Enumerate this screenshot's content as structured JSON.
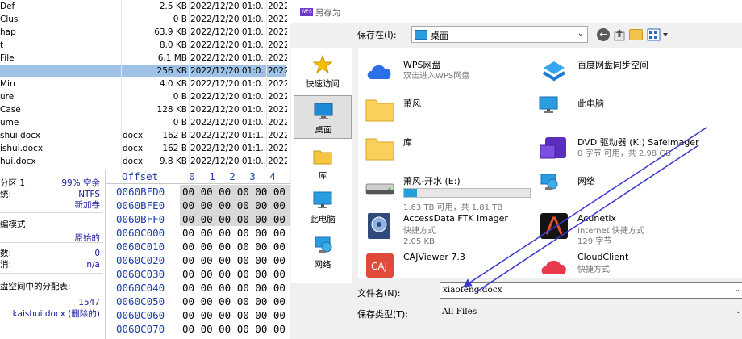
{
  "file_list": {
    "rows": [
      {
        "name": "Def",
        "ext": "",
        "size": "2.5 KB",
        "date": "2022/12/20  01:0...",
        "date2": "2022",
        "selected": false
      },
      {
        "name": "Clus",
        "ext": "",
        "size": "0 B",
        "date": "2022/12/20  01:0...",
        "date2": "2022",
        "selected": false
      },
      {
        "name": "hap",
        "ext": "",
        "size": "63.9 KB",
        "date": "2022/12/20  01:0...",
        "date2": "2022",
        "selected": false
      },
      {
        "name": "t",
        "ext": "",
        "size": "8.0 KB",
        "date": "2022/12/20  01:0...",
        "date2": "2022",
        "selected": false
      },
      {
        "name": "File",
        "ext": "",
        "size": "6.1 MB",
        "date": "2022/12/20  01:0...",
        "date2": "2022",
        "selected": false
      },
      {
        "name": "",
        "ext": "",
        "size": "256 KB",
        "date": "2022/12/20  01:0...",
        "date2": "2022",
        "selected": true
      },
      {
        "name": "Mirr",
        "ext": "",
        "size": "4.0 KB",
        "date": "2022/12/20  01:0...",
        "date2": "2022",
        "selected": false
      },
      {
        "name": "ure",
        "ext": "",
        "size": "0 B",
        "date": "2022/12/20  01:0...",
        "date2": "2022",
        "selected": false
      },
      {
        "name": "Case",
        "ext": "",
        "size": "128 KB",
        "date": "2022/12/20  01:0...",
        "date2": "2022",
        "selected": false
      },
      {
        "name": "ume",
        "ext": "",
        "size": "0 B",
        "date": "2022/12/20  01:0...",
        "date2": "2022",
        "selected": false
      },
      {
        "name": "shui.docx",
        "ext": "docx",
        "size": "162 B",
        "date": "2022/12/20  01:1...",
        "date2": "2022",
        "selected": false
      },
      {
        "name": "ishui.docx",
        "ext": "docx",
        "size": "162 B",
        "date": "2022/12/20  01:1...",
        "date2": "2022",
        "selected": false
      },
      {
        "name": "hui.docx",
        "ext": "docx",
        "size": "9.8 KB",
        "date": "2022/12/20  01:0...",
        "date2": "2022",
        "selected": false
      }
    ]
  },
  "info_panel": {
    "rows": [
      {
        "label": "分区 1",
        "value": "99% 空余"
      },
      {
        "label": "统:",
        "value": "NTFS"
      },
      {
        "label": "",
        "value": "新加卷"
      },
      {
        "label": "编模式",
        "value": ""
      },
      {
        "label": "",
        "value": "原始的"
      },
      {
        "label": "数:",
        "value": "0"
      },
      {
        "label": "消:",
        "value": "n/a"
      },
      {
        "label": "盘空间中的分配表:",
        "value": ""
      },
      {
        "label": "",
        "value": "1547"
      },
      {
        "label": "",
        "value": "kaishui.docx (删除的)"
      }
    ]
  },
  "hex_view": {
    "offset_header": "Offset",
    "columns": [
      "0",
      "1",
      "2",
      "3",
      "4"
    ],
    "rows": [
      {
        "offset": "0060BFD0",
        "bytes": "00 00 00 00 00 00",
        "shaded": true
      },
      {
        "offset": "0060BFE0",
        "bytes": "00 00 00 00 00 00",
        "shaded": true
      },
      {
        "offset": "0060BFF0",
        "bytes": "00 00 00 00 00 00",
        "shaded": true
      },
      {
        "offset": "0060C000",
        "bytes": "00 00 00 00 00 00",
        "shaded": false
      },
      {
        "offset": "0060C010",
        "bytes": "00 00 00 00 00 00",
        "shaded": false
      },
      {
        "offset": "0060C020",
        "bytes": "00 00 00 00 00 00",
        "shaded": false
      },
      {
        "offset": "0060C030",
        "bytes": "00 00 00 00 00 00",
        "shaded": false
      },
      {
        "offset": "0060C040",
        "bytes": "00 00 00 00 00 00",
        "shaded": false
      },
      {
        "offset": "0060C050",
        "bytes": "00 00 00 00 00 00",
        "shaded": false
      },
      {
        "offset": "0060C060",
        "bytes": "00 00 00 00 00 00",
        "shaded": false
      },
      {
        "offset": "0060C070",
        "bytes": "00 00 00 00 00 00",
        "shaded": false
      }
    ]
  },
  "dialog": {
    "title": "另存为",
    "save_in_label": "保存在(I):",
    "save_in_value": "桌面",
    "places": [
      {
        "label": "快速访问",
        "icon": "star-icon",
        "active": false
      },
      {
        "label": "桌面",
        "icon": "desktop-icon",
        "active": true
      },
      {
        "label": "库",
        "icon": "library-folder-icon",
        "active": false
      },
      {
        "label": "此电脑",
        "icon": "computer-icon",
        "active": false
      },
      {
        "label": "网络",
        "icon": "network-icon",
        "active": false
      }
    ],
    "items": [
      {
        "name": "WPS网盘",
        "sub": "双击进入WPS网盘",
        "icon": "cloud-icon"
      },
      {
        "name": "百度网盘同步空间",
        "sub": "",
        "icon": "baidu-sync-icon"
      },
      {
        "name": "萧风",
        "sub": "",
        "icon": "folder-icon"
      },
      {
        "name": "此电脑",
        "sub": "",
        "icon": "computer-icon"
      },
      {
        "name": "库",
        "sub": "",
        "icon": "folder-icon"
      },
      {
        "name": "DVD 驱动器 (K:) SafeImager",
        "sub": "0 字节 可用，共 2.98 GB",
        "icon": "dvd-drive-icon"
      },
      {
        "name": "萧风-开水 (E:)",
        "sub": "1.63 TB 可用，共 1.81 TB",
        "icon": "drive-icon",
        "used_fraction": 0.1
      },
      {
        "name": "网络",
        "sub": "",
        "icon": "network-icon"
      },
      {
        "name": "AccessData FTK Imager",
        "sub": "快捷方式\n2.05 KB",
        "icon": "ftk-imager-icon"
      },
      {
        "name": "Acunetix",
        "sub": "Internet 快捷方式\n129 字节",
        "icon": "acunetix-icon"
      },
      {
        "name": "CAJViewer 7.3",
        "sub": "",
        "icon": "cajviewer-icon"
      },
      {
        "name": "CloudClient",
        "sub": "快捷方式",
        "icon": "cloudclient-icon"
      }
    ],
    "filename_label": "文件名(N):",
    "filename_value": "xiaofeng.docx",
    "filetype_label": "保存类型(T):",
    "filetype_value": "All Files",
    "annotation_color": "#3a3ad0"
  }
}
